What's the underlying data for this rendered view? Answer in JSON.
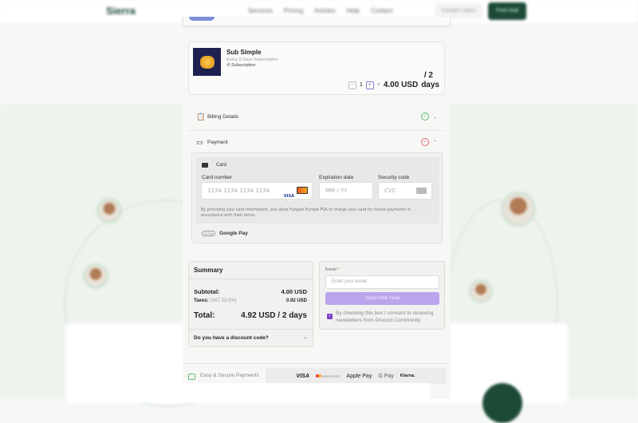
{
  "site": {
    "logo": "Sierra",
    "nav": [
      "Services",
      "Pricing",
      "Articles",
      "Help",
      "Contact"
    ],
    "contact_sales": "Contact sales",
    "free_trial": "Free trial"
  },
  "product": {
    "name": "Sub Simple",
    "subtitle": "Every 2 Days Subscription",
    "tag": "Subscription",
    "quantity": "1",
    "multiply": "×",
    "price": "4.00 USD",
    "period_top": "/ 2",
    "period_bottom": "days"
  },
  "sections": {
    "billing": "Billing Details",
    "payment": "Payment"
  },
  "card": {
    "title": "Card",
    "number_label": "Card number",
    "number_placeholder": "1234 1234 1234 1234",
    "visa": "VISA",
    "exp_label": "Expiration date",
    "exp_placeholder": "MM / YY",
    "cvc_label": "Security code",
    "cvc_placeholder": "CVC",
    "terms": "By providing your card information, you allow Fungies Europe PSA to charge your card for future payments in accordance with their terms.",
    "google_pay": "Google Pay",
    "gpay_icon": "G Pay"
  },
  "summary": {
    "title": "Summary",
    "subtotal_label": "Subtotal:",
    "subtotal": "4.00 USD",
    "taxes_label": "Taxes:",
    "vat": "(VAT 23.0%)",
    "taxes": "0.92 USD",
    "total_label": "Total:",
    "total": "4.92 USD / 2 days",
    "discount": "Do you have a discount code?"
  },
  "email": {
    "label": "Email",
    "required": "*",
    "placeholder": "Enter your email",
    "subscribe": "Subscribe Now",
    "consent": "By checking this box I consent to receiving newsletters from Discord Community"
  },
  "footer": {
    "secure": "Easy & Secure Payments",
    "brands": [
      "VISA",
      "Mastercard",
      "Apple Pay",
      "G Pay",
      "Klarna."
    ]
  },
  "colors": {
    "accent": "#b9a5ec",
    "brand_green": "#1c4a36",
    "check_green": "#5bbf73",
    "check_red": "#e06a6a"
  }
}
